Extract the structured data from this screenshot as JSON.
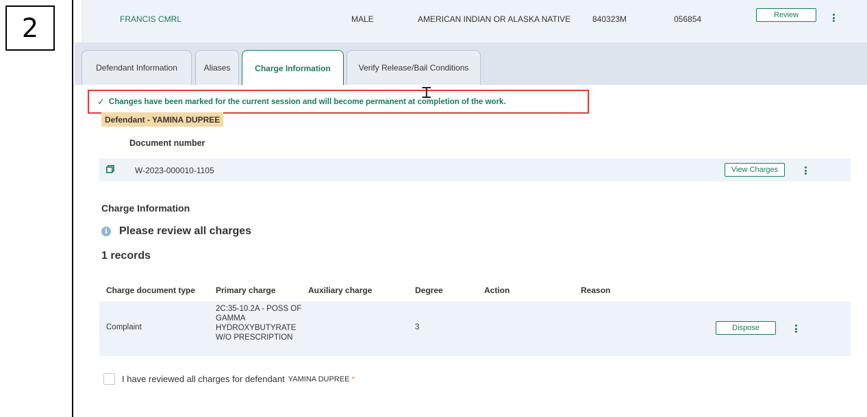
{
  "step_number": "2",
  "header_row": {
    "name": "FRANCIS CMRL",
    "sex": "MALE",
    "race": "AMERICAN INDIAN OR ALASKA NATIVE",
    "id_primary": "840323M",
    "id_secondary": "056854",
    "review_label": "Review"
  },
  "tabs": [
    {
      "label": "Defendant Information",
      "active": false
    },
    {
      "label": "Aliases",
      "active": false
    },
    {
      "label": "Charge Information",
      "active": true
    },
    {
      "label": "Verify Release/Bail Conditions",
      "active": false
    }
  ],
  "success_message": "Changes have been marked for the current session and will become permanent at completion of the work.",
  "defendant_tag": "Defendant - YAMINA DUPREE",
  "document": {
    "header": "Document number",
    "number": "W-2023-000010-1105",
    "view_charges_label": "View Charges"
  },
  "charge_info": {
    "title": "Charge Information",
    "notice": "Please review all charges",
    "records": "1 records",
    "columns": [
      "Charge document type",
      "Primary charge",
      "Auxiliary charge",
      "Degree",
      "Action",
      "Reason"
    ],
    "rows": [
      {
        "document_type": "Complaint",
        "primary_charge": "2C:35-10.2A - POSS OF GAMMA HYDROXYBUTYRATE W/O PRESCRIPTION",
        "auxiliary_charge": "",
        "degree": "3",
        "action": "",
        "reason": "",
        "dispose_label": "Dispose"
      }
    ]
  },
  "review_confirm": {
    "label": "I have reviewed all charges for defendant",
    "defendant": "YAMINA DUPREE",
    "required_marker": "*",
    "checked": false
  },
  "colors": {
    "accent": "#1a7b5a",
    "highlight_border": "#e53935",
    "row_background": "#eef2f9",
    "defendant_tag": "#f5d9a8"
  }
}
